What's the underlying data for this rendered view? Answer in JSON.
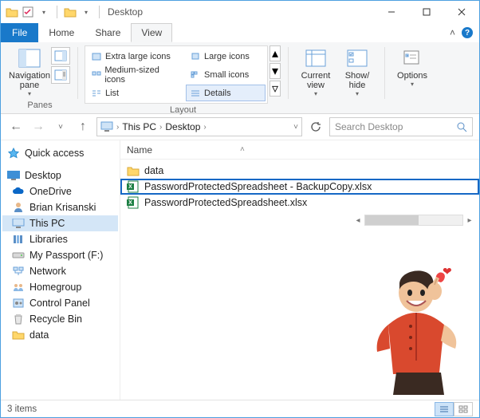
{
  "title": "Desktop",
  "tabs": {
    "file": "File",
    "home": "Home",
    "share": "Share",
    "view": "View"
  },
  "ribbon": {
    "panes": {
      "nav": "Navigation\npane",
      "label": "Panes"
    },
    "layout": {
      "items": [
        "Extra large icons",
        "Large icons",
        "Medium-sized icons",
        "Small icons",
        "List",
        "Details"
      ],
      "label": "Layout"
    },
    "view": {
      "current": "Current\nview",
      "show": "Show/\nhide",
      "options": "Options"
    }
  },
  "breadcrumb": {
    "thispc": "This PC",
    "desktop": "Desktop"
  },
  "search": {
    "placeholder": "Search Desktop"
  },
  "columns": {
    "name": "Name"
  },
  "nav": {
    "quick": "Quick access",
    "desktop": "Desktop",
    "items": [
      "OneDrive",
      "Brian Krisanski",
      "This PC",
      "Libraries",
      "My Passport (F:)",
      "Network",
      "Homegroup",
      "Control Panel",
      "Recycle Bin",
      "data"
    ]
  },
  "files": {
    "rows": [
      {
        "name": "data",
        "type": "folder"
      },
      {
        "name": "PasswordProtectedSpreadsheet - BackupCopy.xlsx",
        "type": "xlsx",
        "highlight": true
      },
      {
        "name": "PasswordProtectedSpreadsheet.xlsx",
        "type": "xlsx"
      }
    ]
  },
  "status": {
    "count": "3 items"
  }
}
